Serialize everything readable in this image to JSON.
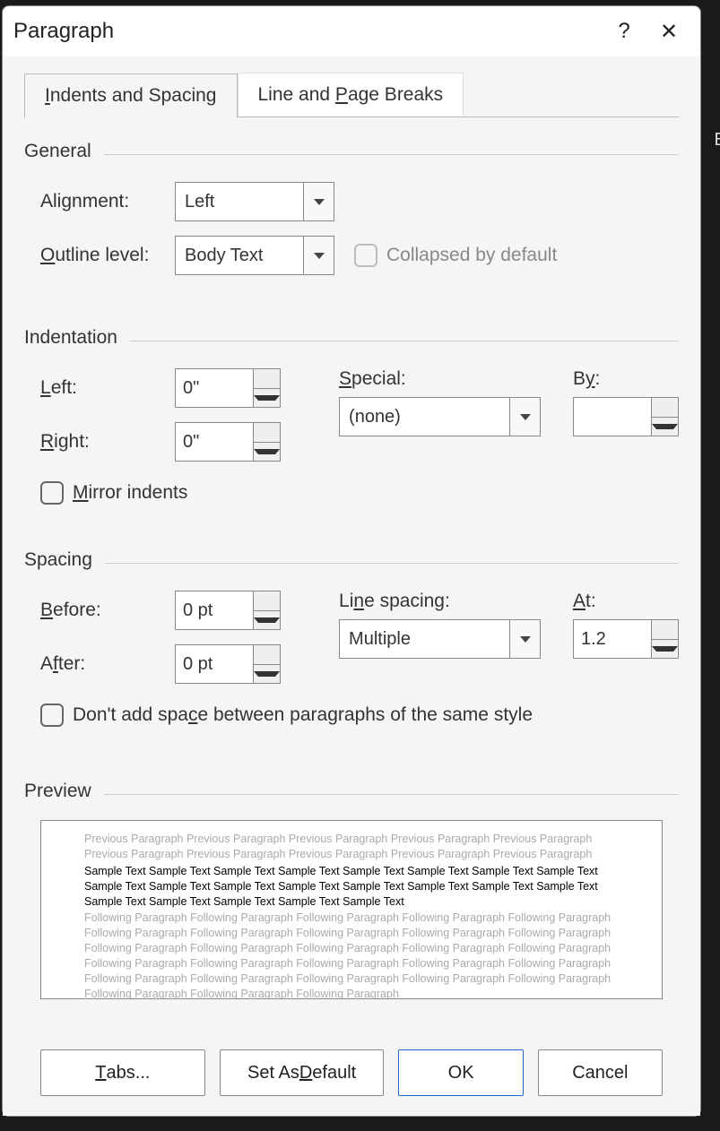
{
  "title": "Paragraph",
  "tabs": {
    "indents": "Indents and Spacing",
    "breaks": "Line and Page Breaks"
  },
  "general": {
    "header": "General",
    "alignment_label": "Alignment:",
    "alignment_value": "Left",
    "outline_label": "Outline level:",
    "outline_value": "Body Text",
    "collapsed_label": "Collapsed by default"
  },
  "indentation": {
    "header": "Indentation",
    "left_label": "Left:",
    "left_value": "0\"",
    "right_label": "Right:",
    "right_value": "0\"",
    "special_label": "Special:",
    "special_value": "(none)",
    "by_label": "By:",
    "by_value": "",
    "mirror_label": "Mirror indents"
  },
  "spacing": {
    "header": "Spacing",
    "before_label": "Before:",
    "before_value": "0 pt",
    "after_label": "After:",
    "after_value": "0 pt",
    "line_label": "Line spacing:",
    "line_value": "Multiple",
    "at_label": "At:",
    "at_value": "1.2",
    "nospace_label": "Don't add space between paragraphs of the same style"
  },
  "preview": {
    "header": "Preview",
    "prev_text": "Previous Paragraph Previous Paragraph Previous Paragraph Previous Paragraph Previous Paragraph Previous Paragraph Previous Paragraph Previous Paragraph Previous Paragraph Previous Paragraph",
    "sample_text": "Sample Text Sample Text Sample Text Sample Text Sample Text Sample Text Sample Text Sample Text Sample Text Sample Text Sample Text Sample Text Sample Text Sample Text Sample Text Sample Text Sample Text Sample Text Sample Text Sample Text Sample Text",
    "next_text": "Following Paragraph Following Paragraph Following Paragraph Following Paragraph Following Paragraph Following Paragraph Following Paragraph Following Paragraph Following Paragraph Following Paragraph Following Paragraph Following Paragraph Following Paragraph Following Paragraph Following Paragraph Following Paragraph Following Paragraph Following Paragraph Following Paragraph Following Paragraph Following Paragraph Following Paragraph Following Paragraph Following Paragraph Following Paragraph Following Paragraph Following Paragraph Following Paragraph"
  },
  "buttons": {
    "tabs": "Tabs...",
    "default": "Set As Default",
    "ok": "OK",
    "cancel": "Cancel"
  },
  "edge": "Ed"
}
